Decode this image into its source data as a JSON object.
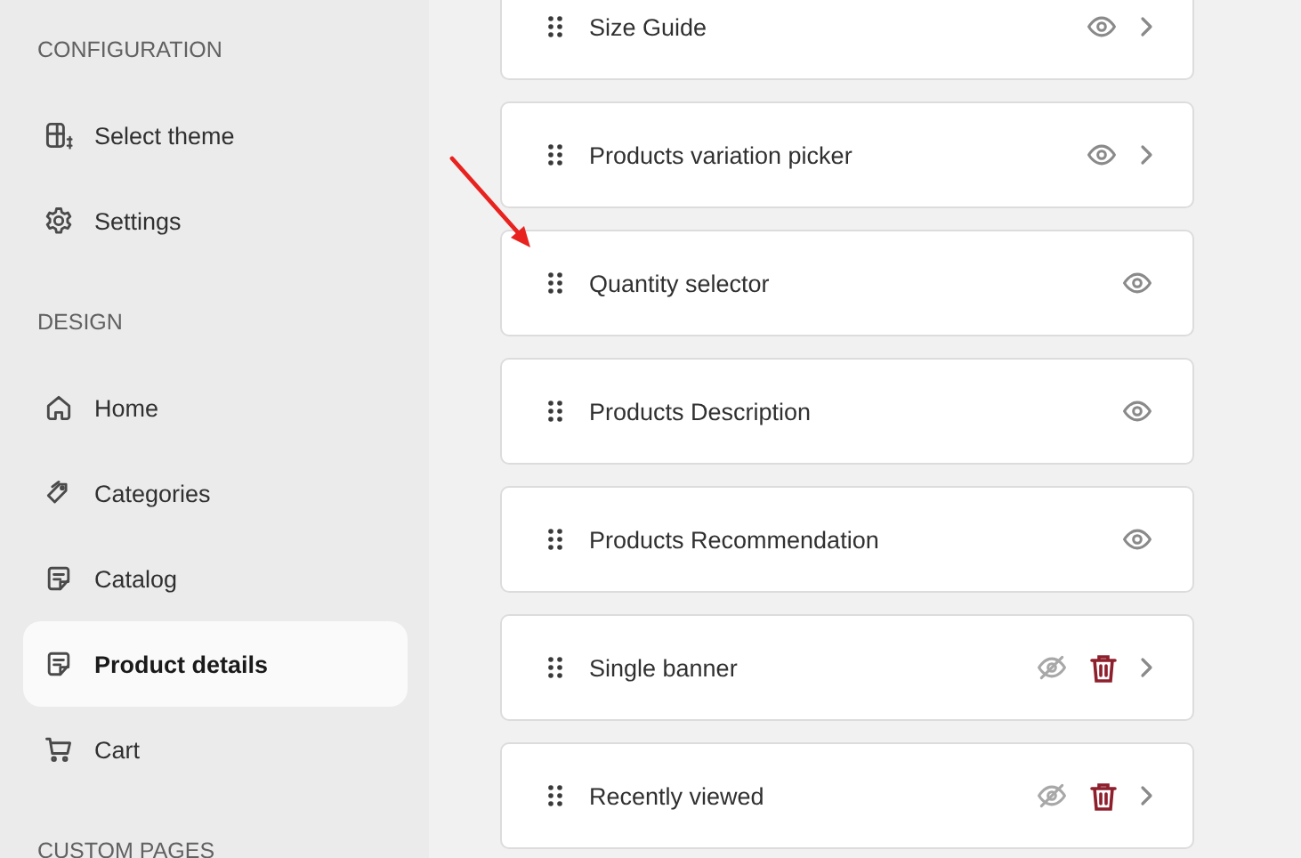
{
  "sidebar": {
    "sections": [
      {
        "title": "CONFIGURATION",
        "items": [
          {
            "label": "Select theme",
            "selected": false
          },
          {
            "label": "Settings",
            "selected": false
          }
        ]
      },
      {
        "title": "DESIGN",
        "items": [
          {
            "label": "Home",
            "selected": false
          },
          {
            "label": "Categories",
            "selected": false
          },
          {
            "label": "Catalog",
            "selected": false
          },
          {
            "label": "Product details",
            "selected": true
          },
          {
            "label": "Cart",
            "selected": false
          }
        ]
      },
      {
        "title": "CUSTOM PAGES"
      }
    ]
  },
  "blocks": [
    {
      "label": "Size Guide",
      "visible": true,
      "deletable": false,
      "expandable": true
    },
    {
      "label": "Products variation picker",
      "visible": true,
      "deletable": false,
      "expandable": true
    },
    {
      "label": "Quantity selector",
      "visible": true,
      "deletable": false,
      "expandable": false
    },
    {
      "label": "Products Description",
      "visible": true,
      "deletable": false,
      "expandable": false
    },
    {
      "label": "Products Recommendation",
      "visible": true,
      "deletable": false,
      "expandable": false
    },
    {
      "label": "Single banner",
      "visible": false,
      "deletable": true,
      "expandable": true
    },
    {
      "label": "Recently viewed",
      "visible": false,
      "deletable": true,
      "expandable": true
    }
  ]
}
